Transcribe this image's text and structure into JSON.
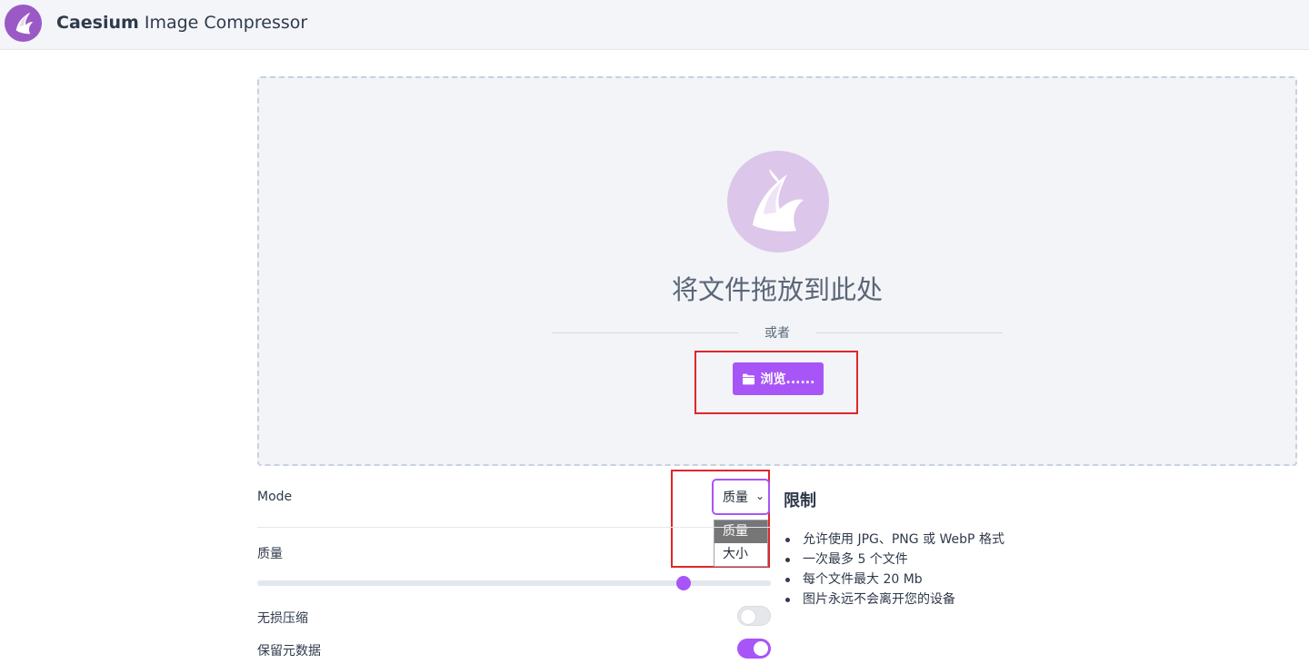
{
  "header": {
    "brand_bold": "Caesium",
    "brand_rest": " Image Compressor"
  },
  "dropzone": {
    "title": "将文件拖放到此处",
    "or_text": "或者",
    "browse_label": "浏览......"
  },
  "settings": {
    "mode_label": "Mode",
    "mode_value": "质量",
    "mode_options": [
      "质量",
      "大小"
    ],
    "quality_label": "质量",
    "quality_level": 0.83,
    "lossless_label": "无损压缩",
    "lossless_on": false,
    "keep_metadata_label": "保留元数据",
    "keep_metadata_on": true
  },
  "limits": {
    "title": "限制",
    "items": [
      "允许使用 JPG、PNG 或 WebP 格式",
      "一次最多 5 个文件",
      "每个文件最大 20 Mb",
      "图片永远不会离开您的设备"
    ]
  },
  "colors": {
    "accent": "#a855f7",
    "logo_circle": "#9b59c6",
    "highlight": "#e0262b"
  }
}
